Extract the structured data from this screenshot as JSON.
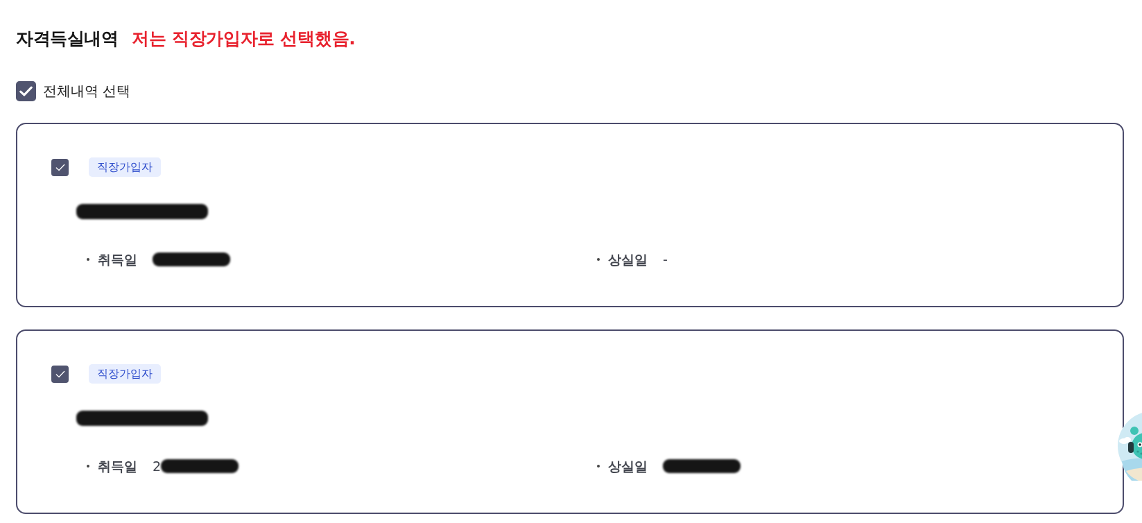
{
  "section": {
    "title": "자격득실내역",
    "note": "저는 직장가입자로 선택했음."
  },
  "select_all": {
    "label": "전체내역 선택",
    "checked": true
  },
  "records": [
    {
      "checked": true,
      "badge": "직장가입자",
      "name_redacted": true,
      "fields": [
        {
          "label": "취득일",
          "redacted": true
        },
        {
          "label": "상실일",
          "value": "-",
          "redacted": false
        }
      ]
    },
    {
      "checked": true,
      "badge": "직장가입자",
      "name_redacted": true,
      "fields": [
        {
          "label": "취득일",
          "value": "2",
          "redacted": true
        },
        {
          "label": "상실일",
          "redacted": true
        }
      ]
    }
  ]
}
